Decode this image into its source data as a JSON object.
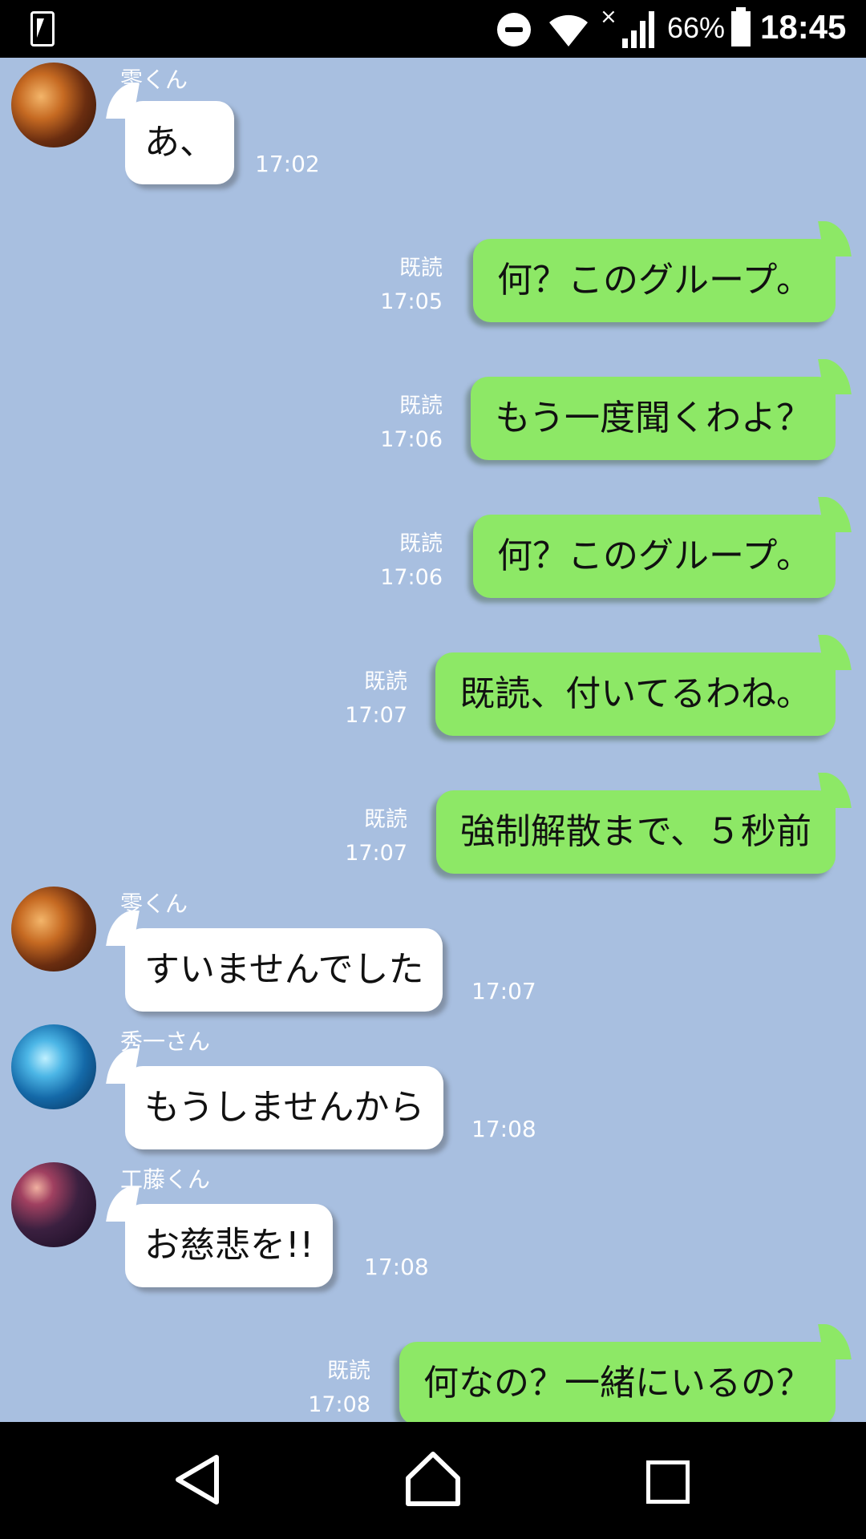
{
  "status_bar": {
    "battery": "66%",
    "time": "18:45",
    "wifi_icon": "wifi-icon",
    "signal_icon": "signal-icon",
    "x_mark": "×"
  },
  "messages": [
    {
      "side": "in",
      "sender": "零くん",
      "text": "あ、",
      "time": "17:02",
      "avatar": "warm"
    },
    {
      "side": "out",
      "read": "既読",
      "text": "何？このグループ。",
      "time": "17:05"
    },
    {
      "side": "out",
      "read": "既読",
      "text": "もう一度聞くわよ？",
      "time": "17:06"
    },
    {
      "side": "out",
      "read": "既読",
      "text": "何？このグループ。",
      "time": "17:06"
    },
    {
      "side": "out",
      "read": "既読",
      "text": "既読、付いてるわね。",
      "time": "17:07"
    },
    {
      "side": "out",
      "read": "既読",
      "text": "強制解散まで、５秒前",
      "time": "17:07"
    },
    {
      "side": "in",
      "sender": "零くん",
      "text": "すいませんでした",
      "time": "17:07",
      "avatar": "warm"
    },
    {
      "side": "in",
      "sender": "秀一さん",
      "text": "もうしませんから",
      "time": "17:08",
      "avatar": "blue"
    },
    {
      "side": "in",
      "sender": "工藤くん",
      "text": "お慈悲を!!",
      "time": "17:08",
      "avatar": "night"
    },
    {
      "side": "out",
      "read": "既読",
      "text": "何なの？一緒にいるの？",
      "time": "17:08"
    }
  ],
  "colors": {
    "background": "#a8bfe0",
    "outgoing_bubble": "#8de866",
    "incoming_bubble": "#ffffff"
  }
}
